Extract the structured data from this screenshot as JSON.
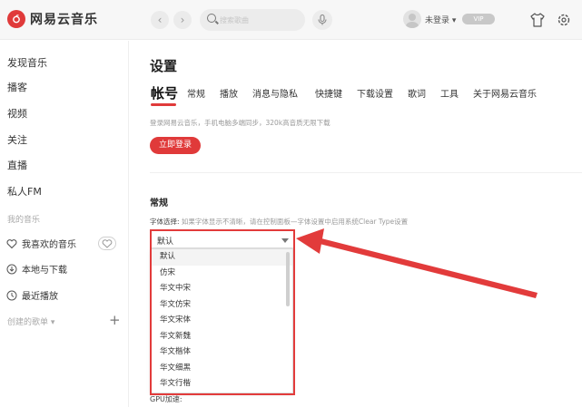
{
  "app": {
    "name": "网易云音乐"
  },
  "header": {
    "search_placeholder": "搜索歌曲",
    "login_text": "未登录 ▾",
    "vip_text": "VIP"
  },
  "sidebar": {
    "items": [
      {
        "label": "发现音乐"
      },
      {
        "label": "播客"
      },
      {
        "label": "视频"
      },
      {
        "label": "关注"
      },
      {
        "label": "直播"
      },
      {
        "label": "私人FM"
      }
    ],
    "my_music_title": "我的音乐",
    "my_music": [
      {
        "label": "我喜欢的音乐",
        "icon": "heart-icon"
      },
      {
        "label": "本地与下载",
        "icon": "download-icon"
      },
      {
        "label": "最近播放",
        "icon": "clock-icon"
      }
    ],
    "created_playlists_title": "创建的歌单 ▾"
  },
  "main": {
    "title": "设置",
    "tabs": [
      {
        "label": "帐号",
        "active": true
      },
      {
        "label": "常规"
      },
      {
        "label": "播放"
      },
      {
        "label": "消息与隐私"
      },
      {
        "label": "快捷键"
      },
      {
        "label": "下载设置"
      },
      {
        "label": "歌词"
      },
      {
        "label": "工具"
      },
      {
        "label": "关于网易云音乐"
      }
    ],
    "account_desc": "登录网易云音乐，手机电脑多端同步，320k高音质无限下载",
    "login_button": "立即登录",
    "general_title": "常规",
    "font_label": "字体选择:",
    "font_hint": "如果字体显示不清晰，请在控制面板—字体设置中启用系统Clear Type设置",
    "font_selected": "默认",
    "font_options": [
      "默认",
      "仿宋",
      "华文中宋",
      "华文仿宋",
      "华文宋体",
      "华文新魏",
      "华文楷体",
      "华文细黑",
      "华文行楷"
    ],
    "gpu_label": "GPU加速:"
  },
  "colors": {
    "accent": "#e03a3a",
    "annotation": "#e23b3b"
  }
}
